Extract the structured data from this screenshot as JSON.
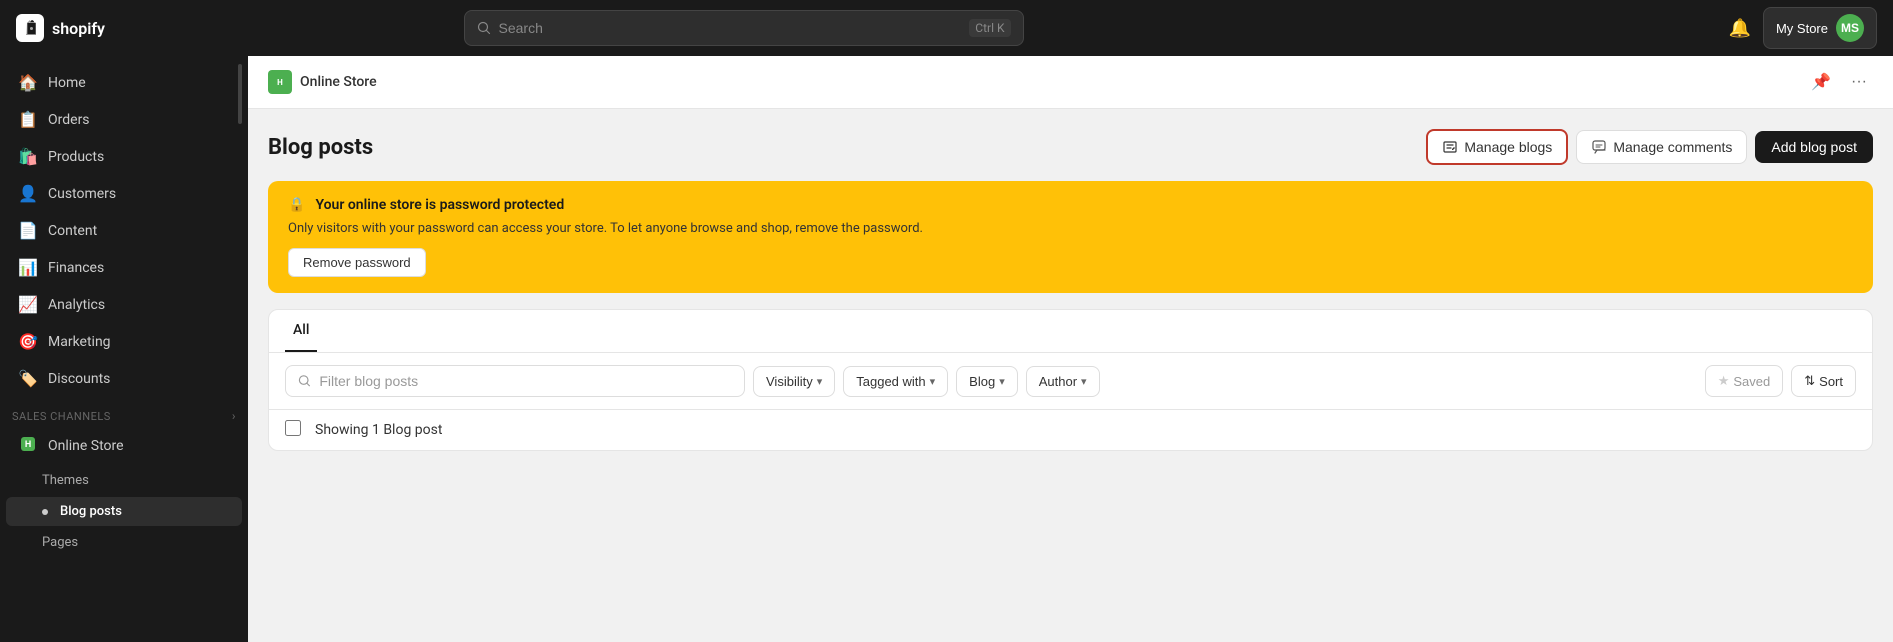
{
  "topbar": {
    "logo_text": "shopify",
    "logo_initials": "S",
    "search_placeholder": "Search",
    "search_shortcut": "Ctrl K",
    "store_name": "My Store",
    "store_initials": "MS"
  },
  "sidebar": {
    "nav_items": [
      {
        "id": "home",
        "label": "Home",
        "icon": "🏠"
      },
      {
        "id": "orders",
        "label": "Orders",
        "icon": "📋"
      },
      {
        "id": "products",
        "label": "Products",
        "icon": "🛍️"
      },
      {
        "id": "customers",
        "label": "Customers",
        "icon": "👤"
      },
      {
        "id": "content",
        "label": "Content",
        "icon": "📄"
      },
      {
        "id": "finances",
        "label": "Finances",
        "icon": "📊"
      },
      {
        "id": "analytics",
        "label": "Analytics",
        "icon": "📈"
      },
      {
        "id": "marketing",
        "label": "Marketing",
        "icon": "🎯"
      },
      {
        "id": "discounts",
        "label": "Discounts",
        "icon": "🏷️"
      }
    ],
    "sales_channels_label": "Sales channels",
    "online_store_label": "Online Store",
    "sub_items": [
      {
        "id": "themes",
        "label": "Themes"
      },
      {
        "id": "blog-posts",
        "label": "Blog posts",
        "active": true
      },
      {
        "id": "pages",
        "label": "Pages"
      }
    ]
  },
  "page_header": {
    "icon_text": "H",
    "title": "Online Store",
    "bell_icon": "🔔",
    "more_icon": "···"
  },
  "blog_posts": {
    "title": "Blog posts",
    "manage_blogs_label": "Manage blogs",
    "manage_comments_label": "Manage comments",
    "add_blog_post_label": "Add blog post",
    "password_warning": {
      "title": "Your online store is password protected",
      "text": "Only visitors with your password can access your store. To let anyone browse and shop, remove the password.",
      "button_label": "Remove password",
      "lock_icon": "🔒"
    },
    "tabs": [
      {
        "id": "all",
        "label": "All",
        "active": true
      }
    ],
    "filters": {
      "search_placeholder": "Filter blog posts",
      "visibility_label": "Visibility",
      "tagged_with_label": "Tagged with",
      "blog_label": "Blog",
      "author_label": "Author",
      "saved_label": "Saved",
      "sort_label": "Sort",
      "sort_icon": "⇅",
      "star_icon": "★"
    },
    "table": {
      "showing_label": "Showing 1 Blog post"
    }
  }
}
